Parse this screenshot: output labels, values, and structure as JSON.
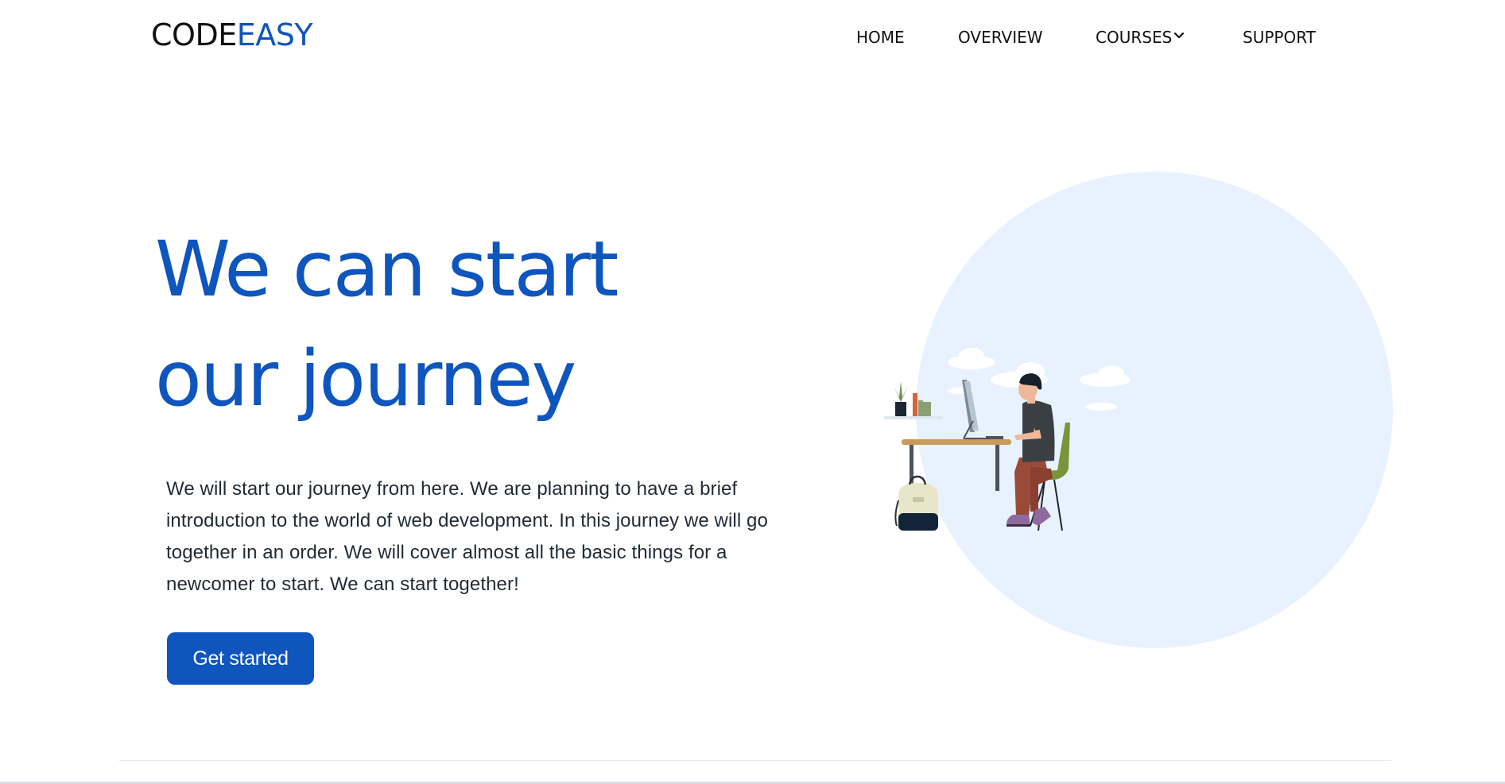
{
  "brand": {
    "part1": "CODE",
    "part2": "EASY",
    "color_dark": "#111111",
    "color_accent": "#0e55be"
  },
  "nav": {
    "items": [
      {
        "label": "HOME"
      },
      {
        "label": "OVERVIEW"
      },
      {
        "label": "COURSES",
        "has_dropdown": true,
        "icon": "chevron-down-icon"
      },
      {
        "label": "SUPPORT"
      }
    ]
  },
  "hero": {
    "title": "We can start our journey",
    "description": "We will start our journey from here. We are planning to have a brief introduction to the world of web development. In this journey we will go together in an order. We will cover almost all the basic things for a newcomer to start. We can start together!",
    "cta_label": "Get started"
  },
  "illustration": {
    "subject": "person-at-desk-illustration",
    "background_color": "#e8f2fe"
  },
  "colors": {
    "primary": "#0e55be",
    "text": "#1f2a35",
    "background": "#ffffff"
  }
}
